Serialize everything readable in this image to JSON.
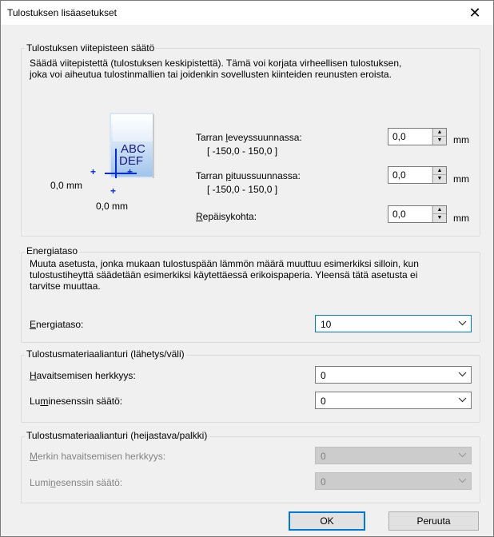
{
  "window": {
    "title": "Tulostuksen lisäasetukset",
    "close_glyph": "✕"
  },
  "reference": {
    "group_title": "Tulostuksen viitepisteen säätö",
    "description_line1": "Säädä viitepistettä (tulostuksen keskipistettä). Tämä voi korjata virheellisen tulostuksen,",
    "description_line2": "joka voi aiheutua tulostinmallien tai joidenkin sovellusten kiinteiden reunusten eroista.",
    "preview": {
      "text_line1": "ABC",
      "text_line2": "DEF",
      "x_offset_label": "0,0 mm",
      "y_offset_label": "0,0 mm"
    },
    "width_label_pre": "Tarran ",
    "width_label_key": "l",
    "width_label_post": "eveyssuunnassa:",
    "width_range": "[ -150,0 - 150,0 ]",
    "width_value": "0,0",
    "length_label_pre": "Tarran ",
    "length_label_key": "p",
    "length_label_post": "ituussuunnassa:",
    "length_range": "[ -150,0 - 150,0 ]",
    "length_value": "0,0",
    "tear_label_key": "R",
    "tear_label_post": "epäisykohta:",
    "tear_value": "0,0",
    "unit": "mm"
  },
  "energy": {
    "group_title": "Energiataso",
    "description_line1": "Muuta asetusta, jonka mukaan tulostuspään lämmön määrä muuttuu esimerkiksi silloin, kun",
    "description_line2": "tulostustiheyttä säädetään esimerkiksi käytettäessä erikoispaperia. Yleensä tätä asetusta ei",
    "description_line3": "tarvitse muuttaa.",
    "label_key": "E",
    "label_post": "nergiataso:",
    "value": "10"
  },
  "transmissive": {
    "group_title": "Tulostusmateriaalianturi (lähetys/väli)",
    "sensitivity_key": "H",
    "sensitivity_post": "avaitsemisen herkkyys:",
    "sensitivity_value": "0",
    "luminance_pre": "Lu",
    "luminance_key": "m",
    "luminance_post": "inesenssin säätö:",
    "luminance_value": "0"
  },
  "reflective": {
    "group_title": "Tulostusmateriaalianturi (heijastava/palkki)",
    "sensitivity_key": "M",
    "sensitivity_post": "erkin havaitsemisen herkkyys:",
    "sensitivity_value": "0",
    "luminance_pre": "Lumi",
    "luminance_key": "n",
    "luminance_post": "esenssin säätö:",
    "luminance_value": "0"
  },
  "buttons": {
    "ok": "OK",
    "cancel": "Peruuta"
  }
}
